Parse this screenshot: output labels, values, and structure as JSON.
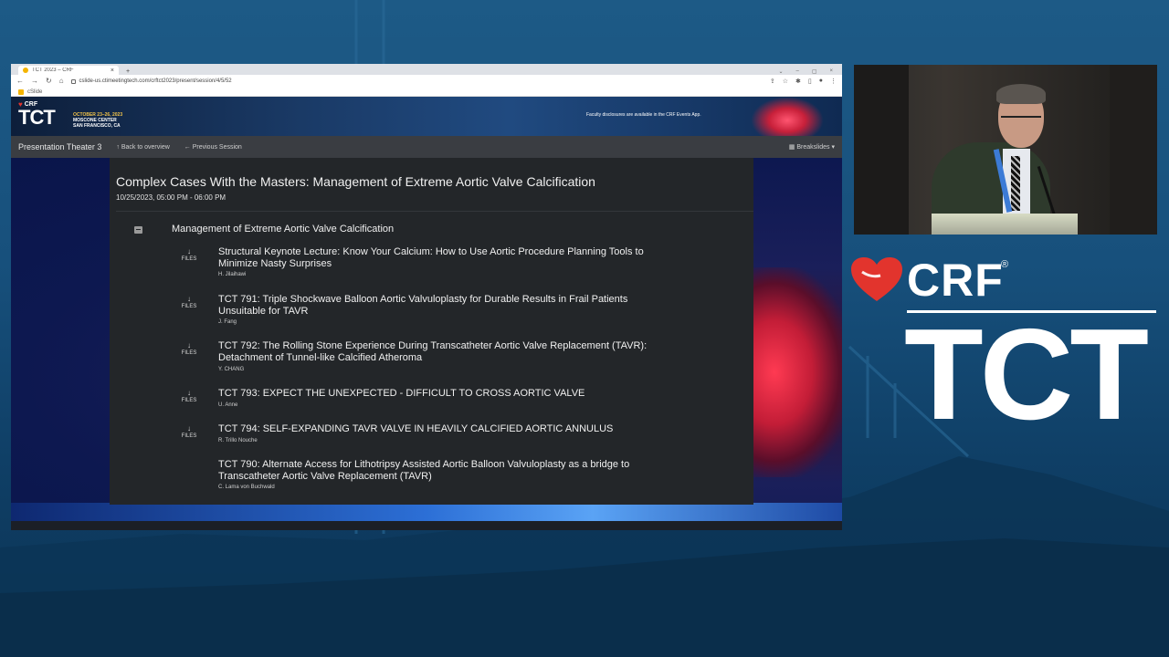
{
  "browser": {
    "tab_title": "TCT 2023 – CRF",
    "url": "cslide-us.ctimeetingtech.com/crftct2023/present/session/4/5/52",
    "bookmark": "cSlide"
  },
  "banner": {
    "crf": "CRF",
    "tct": "TCT",
    "event_dates": "OCTOBER 23–26, 2023",
    "event_venue": "MOSCONE CENTER",
    "event_city": "SAN FRANCISCO, CA",
    "note": "Faculty disclosures are available in the CRF Events App."
  },
  "session_nav": {
    "room": "Presentation Theater 3",
    "back": "Back to overview",
    "previous": "Previous Session",
    "breakslides": "Breakslides"
  },
  "session": {
    "title": "Complex Cases With the Masters: Management of Extreme Aortic Valve Calcification",
    "datetime": "10/25/2023, 05:00 PM - 06:00 PM",
    "group_title": "Management of Extreme Aortic Valve Calcification",
    "files_label": "FILES",
    "talks": [
      {
        "title": "Structural Keynote Lecture: Know Your Calcium: How to Use Aortic Procedure Planning Tools to Minimize Nasty Surprises",
        "speaker": "H. Jilaihawi",
        "has_files": true
      },
      {
        "title": "TCT 791: Triple Shockwave Balloon Aortic Valvuloplasty for Durable Results in Frail Patients Unsuitable for TAVR",
        "speaker": "J. Fang",
        "has_files": true
      },
      {
        "title": "TCT 792: The Rolling Stone Experience During Transcatheter Aortic Valve Replacement (TAVR): Detachment of Tunnel-like Calcified Atheroma",
        "speaker": "Y. CHANG",
        "has_files": true
      },
      {
        "title": "TCT 793: EXPECT THE UNEXPECTED - DIFFICULT TO CROSS AORTIC VALVE",
        "speaker": "U. Anne",
        "has_files": true
      },
      {
        "title": "TCT 794: SELF-EXPANDING TAVR VALVE IN HEAVILY CALCIFIED AORTIC ANNULUS",
        "speaker": "R. Trillo Nouche",
        "has_files": true
      },
      {
        "title": "TCT 790: Alternate Access for Lithotripsy Assisted Aortic Balloon Valvuloplasty as a bridge to Transcatheter Aortic Valve Replacement (TAVR)",
        "speaker": "C. Lama von Buchwald",
        "has_files": false
      }
    ]
  },
  "branding": {
    "crf": "CRF",
    "registered": "®",
    "tct": "TCT",
    "heart_color": "#e2342d"
  },
  "icons": {
    "download": "↓",
    "arrow_up": "↑",
    "arrow_left": "←",
    "grid": "▦"
  }
}
